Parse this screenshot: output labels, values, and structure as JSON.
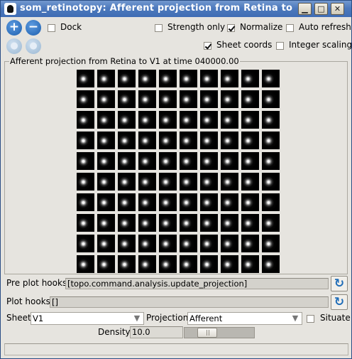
{
  "window": {
    "title": "som_retinotopy: Afferent projection from Retina to"
  },
  "toolbar": {
    "zoom_in_icon": "plus-circle-icon",
    "zoom_out_icon": "minus-circle-icon",
    "dock_label": "Dock",
    "dock_checked": false
  },
  "options": {
    "strength_only": {
      "label": "Strength only",
      "checked": false
    },
    "normalize": {
      "label": "Normalize",
      "checked": true
    },
    "auto_refresh": {
      "label": "Auto refresh",
      "checked": false
    },
    "sheet_coords": {
      "label": "Sheet coords",
      "checked": true
    },
    "integer_scaling": {
      "label": "Integer scaling",
      "checked": false
    }
  },
  "plot": {
    "legend": "Afferent projection from Retina to V1 at time 040000.00",
    "rows": 10,
    "cols": 10
  },
  "hooks": {
    "pre_plot_label": "Pre plot hooks",
    "pre_plot_value": "[topo.command.analysis.update_projection]",
    "plot_label": "Plot hooks",
    "plot_value": "[]"
  },
  "controls": {
    "sheet_label": "Sheet",
    "sheet_value": "V1",
    "projection_label": "Projection",
    "projection_value": "Afferent",
    "situate_label": "Situate",
    "situate_checked": false,
    "density_label": "Density",
    "density_value": "10.0",
    "density_slider_fraction": 0.25
  }
}
